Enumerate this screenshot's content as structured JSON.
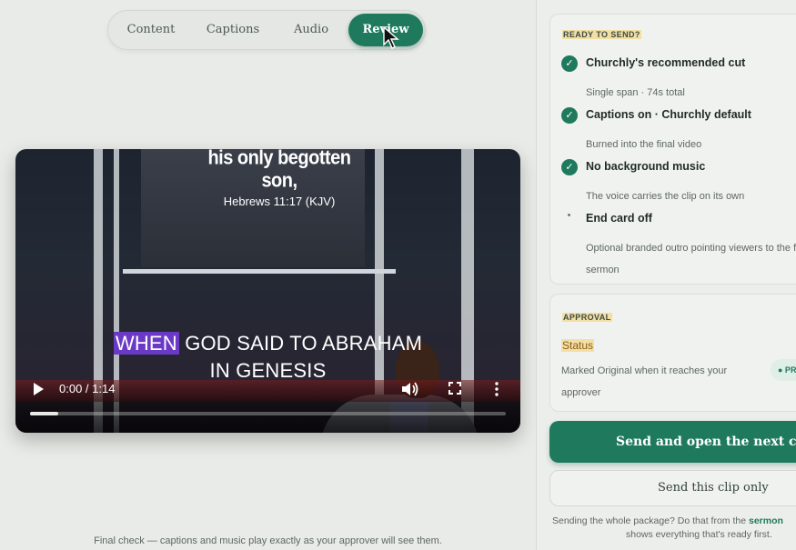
{
  "tabs": [
    {
      "label": "Content",
      "active": false
    },
    {
      "label": "Captions",
      "active": false
    },
    {
      "label": "Audio",
      "active": false
    },
    {
      "label": "Review",
      "active": true
    }
  ],
  "video": {
    "scripture_line": "his only begotten son,",
    "scripture_ref": "Hebrews 11:17 (KJV)",
    "caption_highlight": "WHEN",
    "caption_line1_rest": "GOD SAID TO ABRAHAM",
    "caption_line2": "IN GENESIS",
    "time": "0:00 / 1:14",
    "progress": 0.06
  },
  "final_note": "Final check — captions and music play exactly as your approver will see them.",
  "ready": {
    "label": "READY TO SEND?",
    "items": [
      {
        "title": "Churchly's recommended cut",
        "sub": "Single span · 74s total",
        "checked": true
      },
      {
        "title": "Captions on · Churchly default",
        "sub": "Burned into the final video",
        "checked": true
      },
      {
        "title": "No background music",
        "sub": "The voice carries the clip on its own",
        "checked": true
      },
      {
        "title": "End card off",
        "sub": "Optional branded outro pointing viewers to the full sermon",
        "checked": false
      }
    ]
  },
  "approval": {
    "label": "APPROVAL",
    "status_label": "Status",
    "status_text": "Marked Original when it reaches your approver",
    "pill": "● PRE"
  },
  "actions": {
    "primary": "Send and open the next clip →",
    "secondary": "Send this clip only"
  },
  "footnote": {
    "line1_pre": "Sending the whole package? Do that from the ",
    "link": "sermon",
    "line2": "shows everything that's ready first."
  },
  "colors": {
    "accent": "#1f7a5d",
    "caption_highlight": "#6a3ac7",
    "label_highlight": "#f3dfa4"
  }
}
